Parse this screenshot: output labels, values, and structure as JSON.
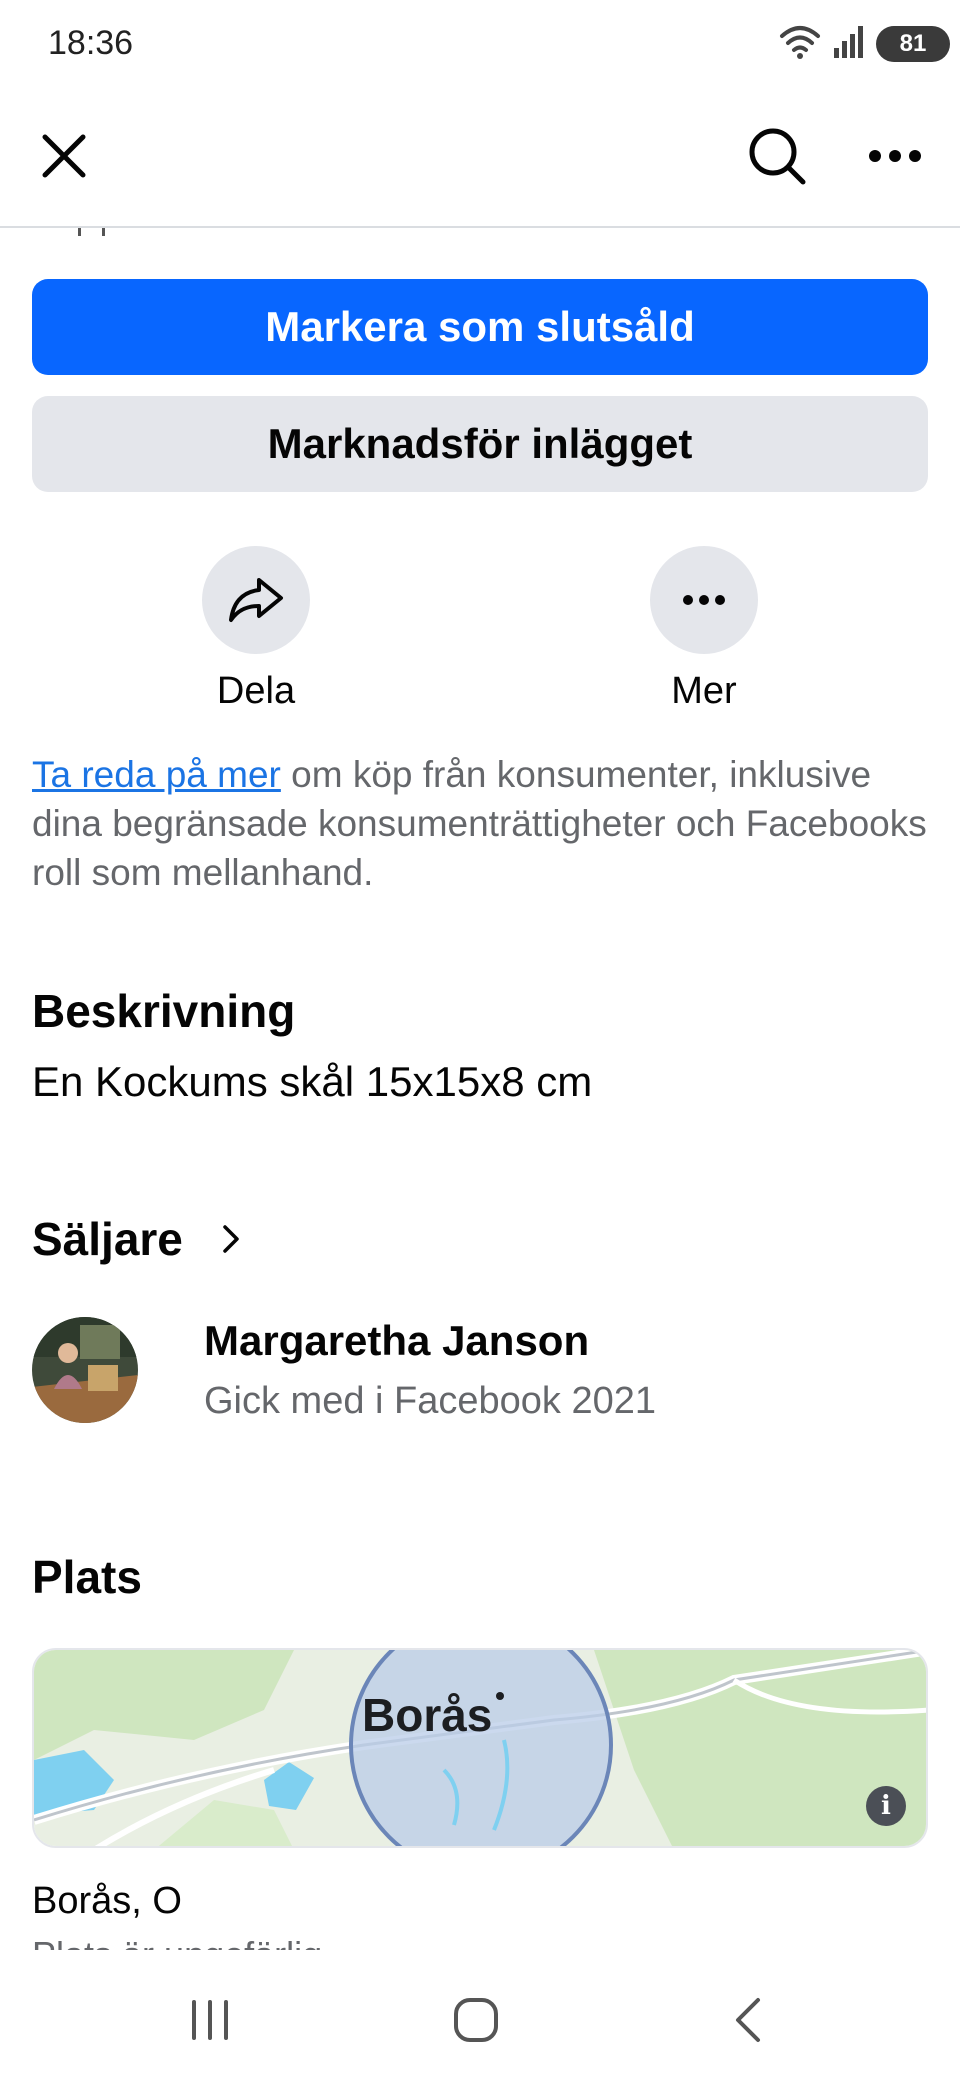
{
  "status_bar": {
    "time": "18:36",
    "battery": "81"
  },
  "nav": {
    "close_icon": "close-icon",
    "search_icon": "search-icon",
    "more_icon": "more-horizontal-icon"
  },
  "actions": {
    "mark_sold": "Markera som slutsåld",
    "promote": "Marknadsför inlägget",
    "share": "Dela",
    "more": "Mer"
  },
  "info": {
    "link": "Ta reda på mer",
    "text": " om köp från konsumenter, inklusive dina begränsade konsumenträttigheter och Facebooks roll som mellanhand."
  },
  "description": {
    "title": "Beskrivning",
    "text": "En Kockums skål 15x15x8 cm"
  },
  "seller": {
    "title": "Säljare",
    "name": "Margaretha Janson",
    "joined": "Gick med i Facebook 2021"
  },
  "location": {
    "title": "Plats",
    "map_label": "Borås",
    "place": "Borås, O",
    "note": "Plats är ungefärlig",
    "info_glyph": "i"
  },
  "colors": {
    "primary": "#0866ff",
    "secondary": "#e4e6eb",
    "link": "#1b74e4",
    "muted": "#65676b"
  }
}
